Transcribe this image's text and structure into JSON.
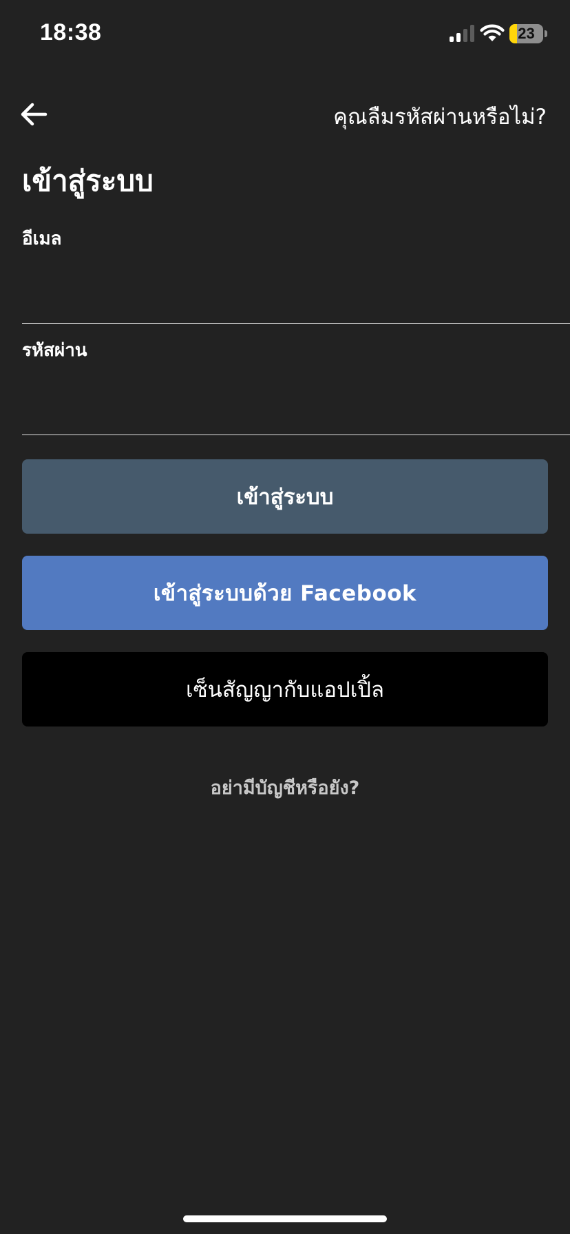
{
  "status_bar": {
    "time": "18:38",
    "battery_level": "23",
    "battery_color": "#ffd60a",
    "icons": [
      "signal-icon",
      "wifi-icon",
      "battery-icon"
    ]
  },
  "nav": {
    "back_icon": "arrow-left-icon",
    "forgot_password": "คุณลืมรหัสผ่านหรือไม่?"
  },
  "title": "เข้าสู่ระบบ",
  "form": {
    "email_label": "อีเมล",
    "email_value": "",
    "password_label": "รหัสผ่าน",
    "password_value": ""
  },
  "buttons": {
    "login": "เข้าสู่ระบบ",
    "facebook": "เข้าสู่ระบบด้วย Facebook",
    "apple": "เซ็นสัญญากับแอปเปิ้ล"
  },
  "signup_prompt": "อย่ามีบัญชีหรือยัง?",
  "colors": {
    "background": "#222222",
    "login_button": "#465a6c",
    "facebook_button": "#527ac1",
    "apple_button": "#000000"
  }
}
